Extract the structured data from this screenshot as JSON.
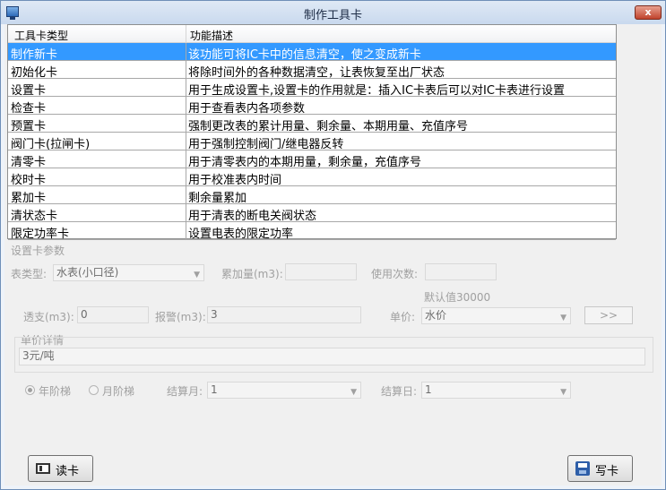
{
  "window": {
    "title": "制作工具卡",
    "close_label": "x"
  },
  "table": {
    "columns": [
      "工具卡类型",
      "功能描述"
    ],
    "rows": [
      {
        "type": "制作新卡",
        "desc": "该功能可将IC卡中的信息清空，使之变成新卡",
        "selected": true
      },
      {
        "type": "初始化卡",
        "desc": "将除时间外的各种数据清空，让表恢复至出厂状态"
      },
      {
        "type": "设置卡",
        "desc": "用于生成设置卡,设置卡的作用就是：插入IC卡表后可以对IC卡表进行设置"
      },
      {
        "type": "检查卡",
        "desc": "用于查看表内各项参数"
      },
      {
        "type": "预置卡",
        "desc": "强制更改表的累计用量、剩余量、本期用量、充值序号"
      },
      {
        "type": "阀门卡(拉闸卡)",
        "desc": "用于强制控制阀门/继电器反转"
      },
      {
        "type": "清零卡",
        "desc": "用于清零表内的本期用量，剩余量，充值序号"
      },
      {
        "type": "校时卡",
        "desc": "用于校准表内时间"
      },
      {
        "type": "累加卡",
        "desc": "剩余量累加"
      },
      {
        "type": "清状态卡",
        "desc": "用于清表的断电关阀状态"
      },
      {
        "type": "限定功率卡",
        "desc": "设置电表的限定功率"
      }
    ]
  },
  "settings": {
    "group_label": "设置卡参数",
    "meter_type_label": "表类型:",
    "meter_type_value": "水表(小口径)",
    "accum_label": "累加量(m3):",
    "accum_value": "",
    "use_count_label": "使用次数:",
    "use_count_value": "",
    "default_hint": "默认值30000",
    "overdraft_label": "透支(m3):",
    "overdraft_value": "0",
    "alarm_label": "报警(m3):",
    "alarm_value": "3",
    "price_label": "单价:",
    "price_value": "水价",
    "more_button": ">>",
    "price_detail_label": "单价详情",
    "price_detail_value": "3元/吨",
    "year_tier_label": "年阶梯",
    "month_tier_label": "月阶梯",
    "settle_month_label": "结算月:",
    "settle_month_value": "1",
    "settle_day_label": "结算日:",
    "settle_day_value": "1"
  },
  "actions": {
    "read_label": "读卡",
    "write_label": "写卡"
  }
}
